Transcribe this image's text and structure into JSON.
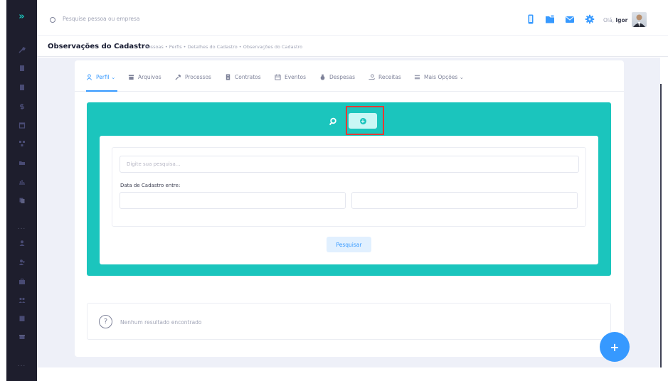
{
  "sidebar": {
    "toggle_label": "»",
    "dots_label": "...",
    "icons": [
      "wrench-icon",
      "file-icon",
      "file-icon",
      "dollar-icon",
      "calendar-icon",
      "network-icon",
      "folder-icon",
      "chart-icon",
      "copy-icon",
      "dots-icon",
      "user-icon",
      "user-plus-icon",
      "briefcase-icon",
      "users-icon",
      "clipboard-icon",
      "gift-icon",
      "dots-icon"
    ]
  },
  "topbar": {
    "search_placeholder": "Pesquise pessoa ou empresa",
    "greeting": "Olá,",
    "user_name": "Igor"
  },
  "subheader": {
    "title": "Observações do Cadastro",
    "breadcrumb": "Pessoas • Perfis • Detalhes do Cadastro • Observações do Cadastro"
  },
  "tabs": [
    {
      "label": "Perfil ⌄",
      "icon": "user-icon"
    },
    {
      "label": "Arquivos",
      "icon": "archive-icon"
    },
    {
      "label": "Processos",
      "icon": "hammer-icon"
    },
    {
      "label": "Contratos",
      "icon": "document-icon"
    },
    {
      "label": "Eventos",
      "icon": "calendar-icon"
    },
    {
      "label": "Despesas",
      "icon": "moneybag-icon"
    },
    {
      "label": "Receitas",
      "icon": "hand-coin-icon"
    },
    {
      "label": "Mais Opções ⌄",
      "icon": "menu-icon"
    }
  ],
  "filter": {
    "search_placeholder": "Digite sua pesquisa...",
    "date_label": "Data de Cadastro entre:",
    "search_button": "Pesquisar"
  },
  "add_button_symbol": "+",
  "result": {
    "icon_symbol": "?",
    "empty_text": "Nenhum resultado encontrado"
  },
  "fab_symbol": "+",
  "colors": {
    "accent": "#1bc5bd",
    "primary": "#3699ff",
    "highlight": "#e53935",
    "sidebar": "#1e1e2d"
  }
}
